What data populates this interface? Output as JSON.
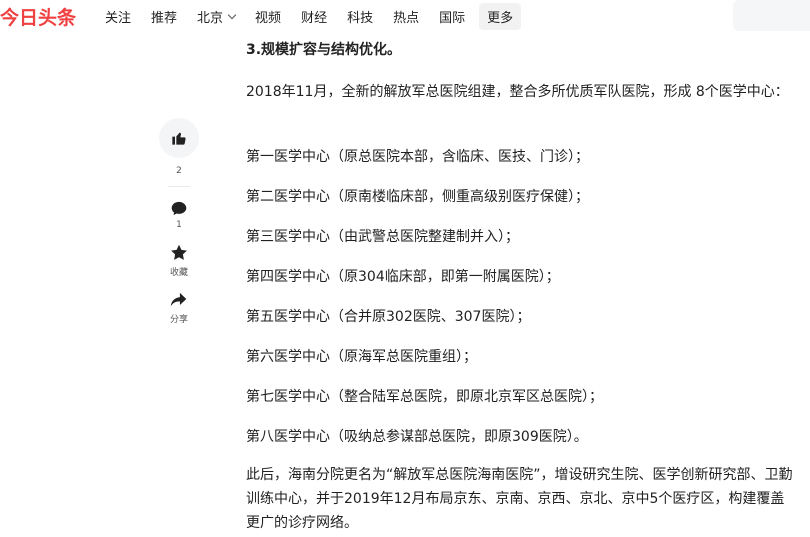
{
  "header": {
    "logo": "今日头条",
    "nav": [
      "关注",
      "推荐",
      "北京",
      "视频",
      "财经",
      "科技",
      "热点",
      "国际"
    ],
    "more": "更多"
  },
  "sidebar": {
    "like_count": "2",
    "comment_count": "1",
    "favorite_label": "收藏",
    "share_label": "分享"
  },
  "article": {
    "section_title": "3.规模扩容与结构优化。",
    "intro": "2018年11月，全新的解放军总医院组建，整合多所优质军队医院，形成 8个医学中心：",
    "centers": [
      "第一医学中心（原总医院本部，含临床、医技、门诊）；",
      "第二医学中心（原南楼临床部，侧重高级别医疗保健）；",
      "第三医学中心（由武警总医院整建制并入）；",
      "第四医学中心（原304临床部，即第一附属医院）；",
      "第五医学中心（合并原302医院、307医院）；",
      "第六医学中心（原海军总医院重组）；",
      "第七医学中心（整合陆军总医院，即原北京军区总医院）；",
      "第八医学中心（吸纳总参谋部总医院，即原309医院）。"
    ],
    "closing": "此后，海南分院更名为“解放军总医院海南医院”，增设研究生院、医学创新研究部、卫勤训练中心，并于2019年12月布局京东、京南、京西、京北、京中5个医疗区，构建覆盖更广的诊疗网络。"
  },
  "colors": {
    "brand": "#f04142",
    "text": "#222222"
  },
  "icons": [
    "thumbs-up-icon",
    "comment-icon",
    "star-icon",
    "share-icon",
    "chevron-down-icon"
  ]
}
